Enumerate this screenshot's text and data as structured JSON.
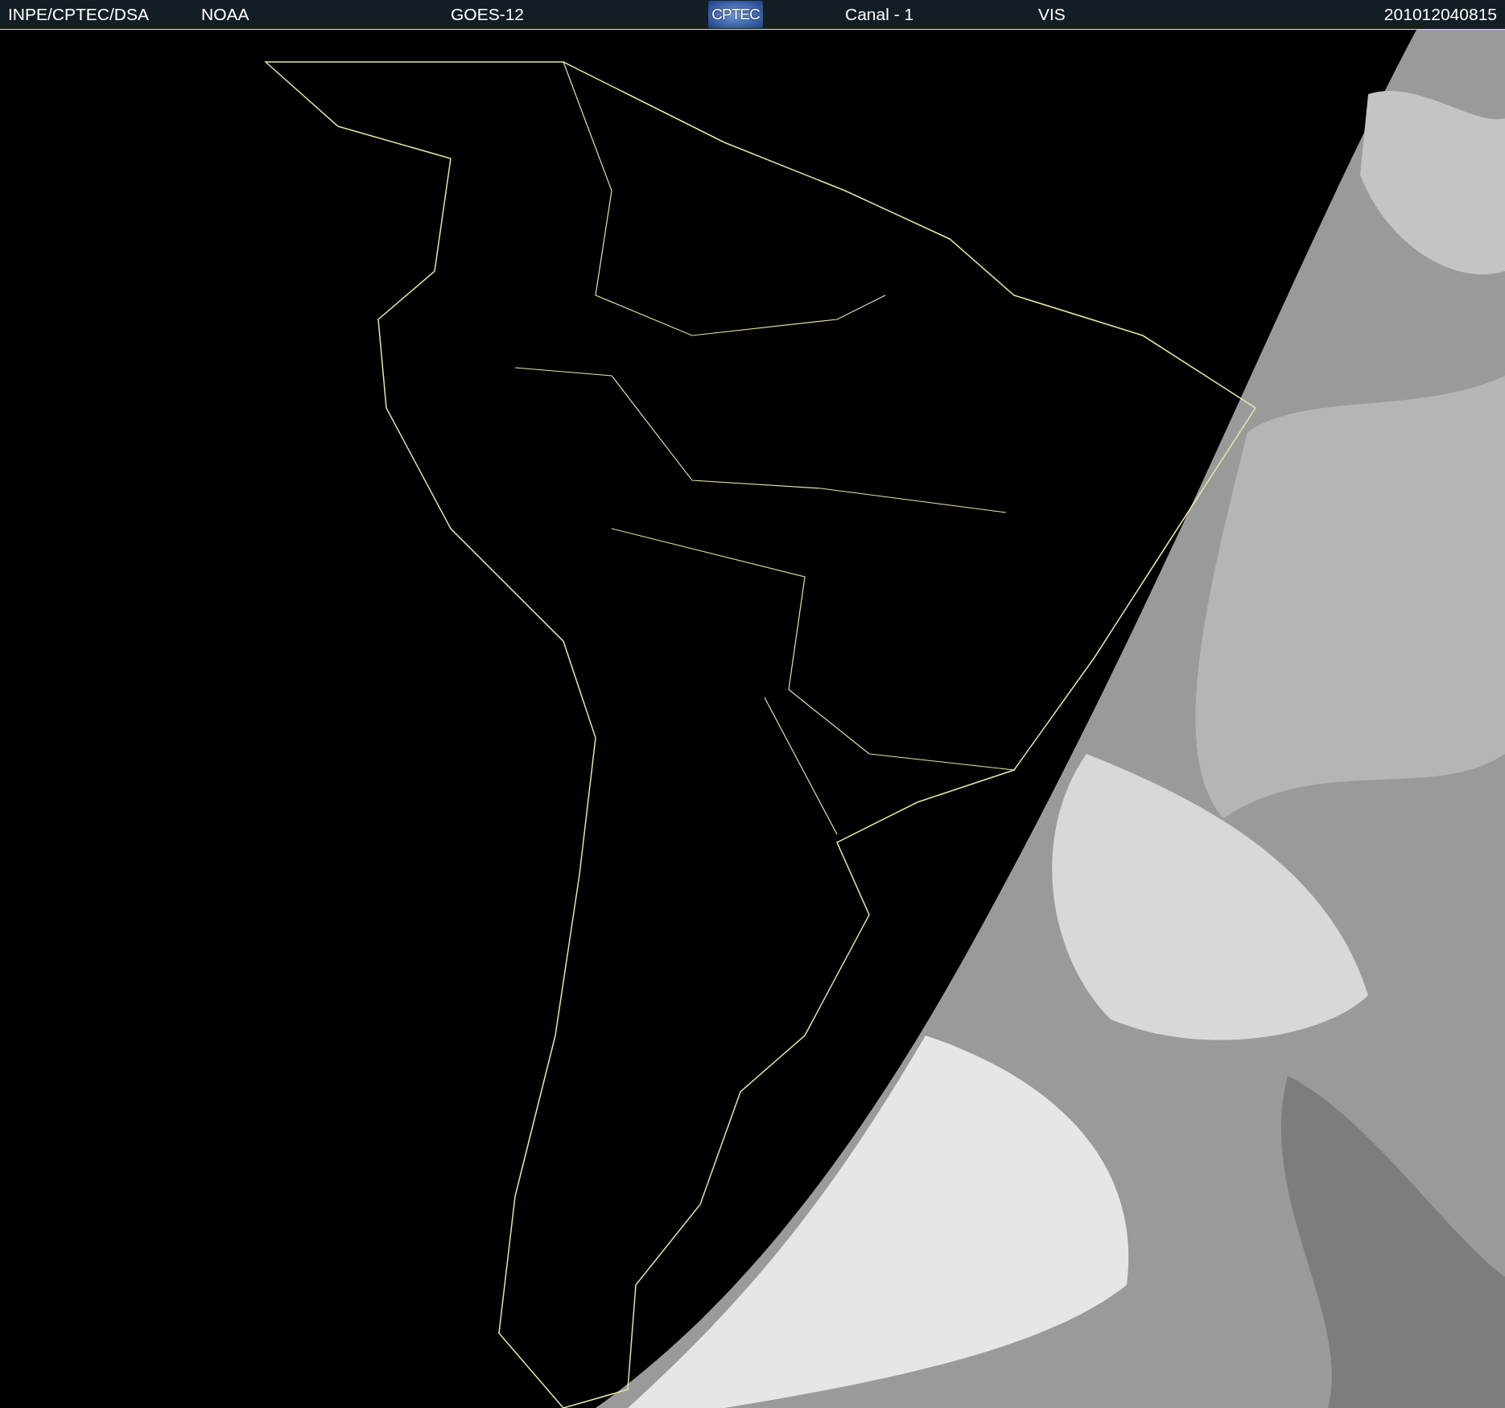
{
  "header": {
    "items": [
      {
        "kind": "text",
        "text": "INPE/CPTEC/DSA"
      },
      {
        "kind": "text",
        "text": "NOAA"
      },
      {
        "kind": "text",
        "text": "GOES-12"
      },
      {
        "kind": "logo",
        "text": "CPTEC"
      },
      {
        "kind": "text",
        "text": "Canal - 1"
      },
      {
        "kind": "text",
        "text": "VIS"
      },
      {
        "kind": "text",
        "text": "201012040815"
      }
    ]
  }
}
